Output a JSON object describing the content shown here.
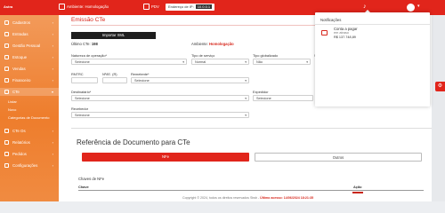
{
  "topbar": {
    "logo": "Astra",
    "env_label": "Ambiente: Homologação",
    "pdv_label": "PDV",
    "ip_label": "Endereço de IP:",
    "ip_value": "10.0.0.1"
  },
  "sidebar": {
    "items": [
      {
        "label": "Cadastros"
      },
      {
        "label": "Entradas"
      },
      {
        "label": "Gestão Pessoal"
      },
      {
        "label": "Estoque"
      },
      {
        "label": "Vendas"
      },
      {
        "label": "Financeiro"
      },
      {
        "label": "CTe"
      },
      {
        "label": "CTe Os"
      },
      {
        "label": "Relatórios"
      },
      {
        "label": "Pedidos"
      },
      {
        "label": "Configurações"
      }
    ],
    "subitems": [
      {
        "label": "Listar"
      },
      {
        "label": "Novo"
      },
      {
        "label": "Categorias de Documento"
      }
    ]
  },
  "page": {
    "title": "Emissão CTe",
    "import_button": "Importar XML",
    "ultimo_label": "Último CTe:",
    "ultimo_value": "198",
    "ambiente_label": "Ambiente:",
    "ambiente_value": "Homologação"
  },
  "form": {
    "natureza": {
      "label": "Natureza de operação*",
      "value": "Selecione"
    },
    "tipo_servico": {
      "label": "Tipo de serviço",
      "value": "Normal"
    },
    "tipo_globalizado": {
      "label": "Tipo globalizado",
      "value": "Não"
    },
    "tipo_cte": {
      "label": "S",
      "value": "S"
    },
    "rntrc": {
      "label": "RNTRC",
      "value": ""
    },
    "ie": {
      "label": "Nº/IE. (R)",
      "value": ""
    },
    "remetente": {
      "label": "Remetente*",
      "value": "Selecione"
    },
    "destinatario": {
      "label": "Destinatário*",
      "value": "Selecione"
    },
    "expedidor": {
      "label": "Expedidor",
      "value": "Selecione"
    },
    "recebedor": {
      "label": "Recebedor",
      "value": "Selecione"
    }
  },
  "referencia": {
    "title": "Referência de Documento para CTe",
    "tab_nfe": "NFe",
    "tab_outros": "Outros",
    "chaves_label": "Chaves de NFe",
    "col_chave": "Chave",
    "col_acao": "Ação"
  },
  "footer": {
    "text": "Copyright © 2024, todos os direitos reservados Stwb -",
    "highlight": "Último acesso: 14/06/2024 18:21:35"
  },
  "notifications": {
    "title": "Notificações",
    "item_title": "Conta a pagar",
    "item_subtitle": "em atraso",
    "item_value": "R$ 137.748,89"
  },
  "colors": {
    "primary": "#e1251b",
    "sidebar": "#ee7d2c",
    "dark_button": "#1d1d1d"
  }
}
